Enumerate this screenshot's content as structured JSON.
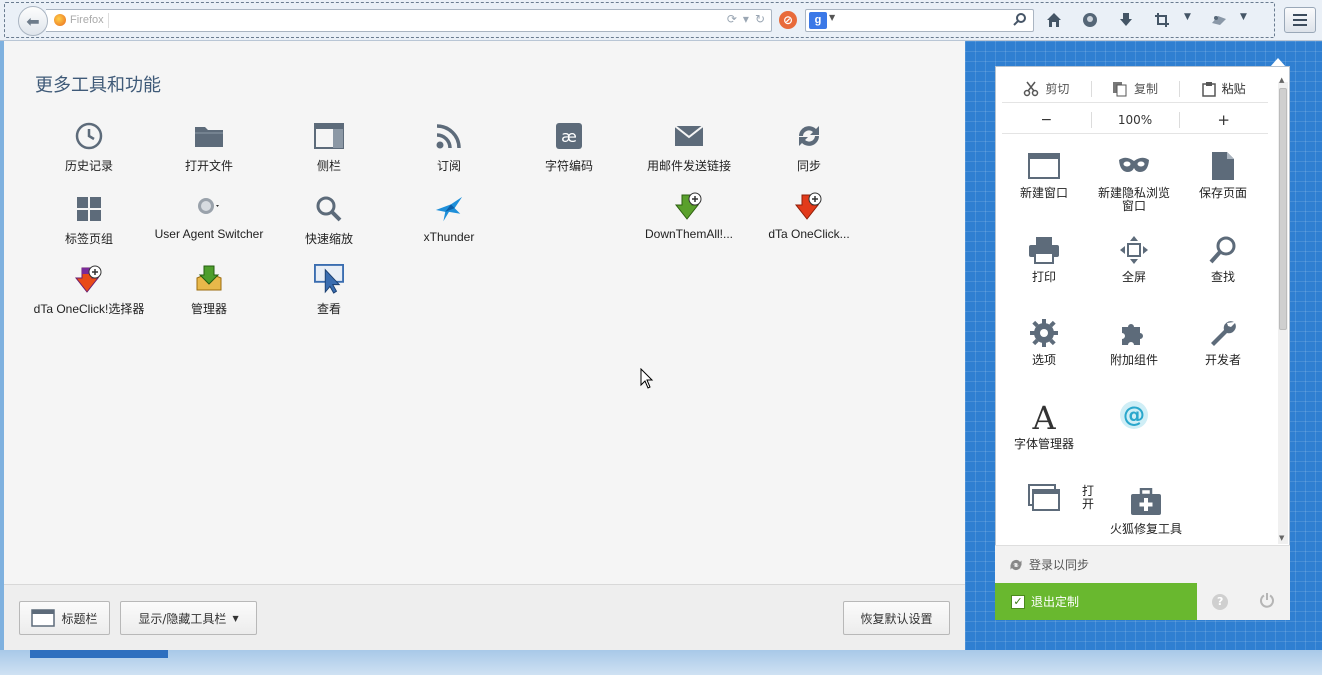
{
  "toolbar": {
    "url_identity": "Firefox",
    "search_engine": "g",
    "icons": [
      "back-icon",
      "reload-icon",
      "home-icon",
      "adblock-icon",
      "download-icon",
      "crop-icon",
      "addon-icon",
      "menu-icon"
    ]
  },
  "palette": {
    "title": "更多工具和功能",
    "items": [
      {
        "label": "历史记录",
        "icon": "history-icon"
      },
      {
        "label": "打开文件",
        "icon": "folder-icon"
      },
      {
        "label": "侧栏",
        "icon": "sidebar-icon"
      },
      {
        "label": "订阅",
        "icon": "rss-icon"
      },
      {
        "label": "字符编码",
        "icon": "encoding-icon"
      },
      {
        "label": "用邮件发送链接",
        "icon": "email-icon"
      },
      {
        "label": "同步",
        "icon": "sync-icon"
      },
      {
        "label": "标签页组",
        "icon": "tab-groups-icon"
      },
      {
        "label": "User Agent Switcher",
        "icon": "user-agent-icon"
      },
      {
        "label": "快速缩放",
        "icon": "zoom-icon"
      },
      {
        "label": "xThunder",
        "icon": "xthunder-icon"
      },
      {
        "label": "DownThemAll!...",
        "icon": "downthemall-icon"
      },
      {
        "label": "dTa OneClick...",
        "icon": "dta-oneclick-icon"
      },
      {
        "label": "dTa OneClick!选择器",
        "icon": "dta-selector-icon"
      },
      {
        "label": "管理器",
        "icon": "manager-icon"
      },
      {
        "label": "查看",
        "icon": "inspect-icon"
      }
    ]
  },
  "footer": {
    "titlebar_label": "标题栏",
    "toolbars_label": "显示/隐藏工具栏",
    "restore_label": "恢复默认设置"
  },
  "panel": {
    "cut_label": "剪切",
    "copy_label": "复制",
    "paste_label": "粘贴",
    "zoom_out": "−",
    "zoom_level": "100%",
    "zoom_in": "+",
    "items": [
      {
        "label": "新建窗口",
        "icon": "new-window-icon"
      },
      {
        "label": "新建隐私浏览窗口",
        "icon": "private-window-icon"
      },
      {
        "label": "保存页面",
        "icon": "save-page-icon"
      },
      {
        "label": "打印",
        "icon": "print-icon"
      },
      {
        "label": "全屏",
        "icon": "fullscreen-icon"
      },
      {
        "label": "查找",
        "icon": "find-icon"
      },
      {
        "label": "选项",
        "icon": "options-icon"
      },
      {
        "label": "附加组件",
        "icon": "addons-icon"
      },
      {
        "label": "开发者",
        "icon": "developer-icon"
      },
      {
        "label": "字体管理器",
        "icon": "font-manager-icon"
      },
      {
        "label": "",
        "icon": "at-icon"
      },
      {
        "label": "打开",
        "icon": "open-window-icon"
      },
      {
        "label": "火狐修复工具",
        "icon": "repair-tool-icon"
      }
    ],
    "sync_label": "登录以同步",
    "exit_label": "退出定制"
  },
  "colors": {
    "accent_green": "#69b82f",
    "panel_blue": "#2f7fd1",
    "title_blue": "#3f5a78"
  }
}
